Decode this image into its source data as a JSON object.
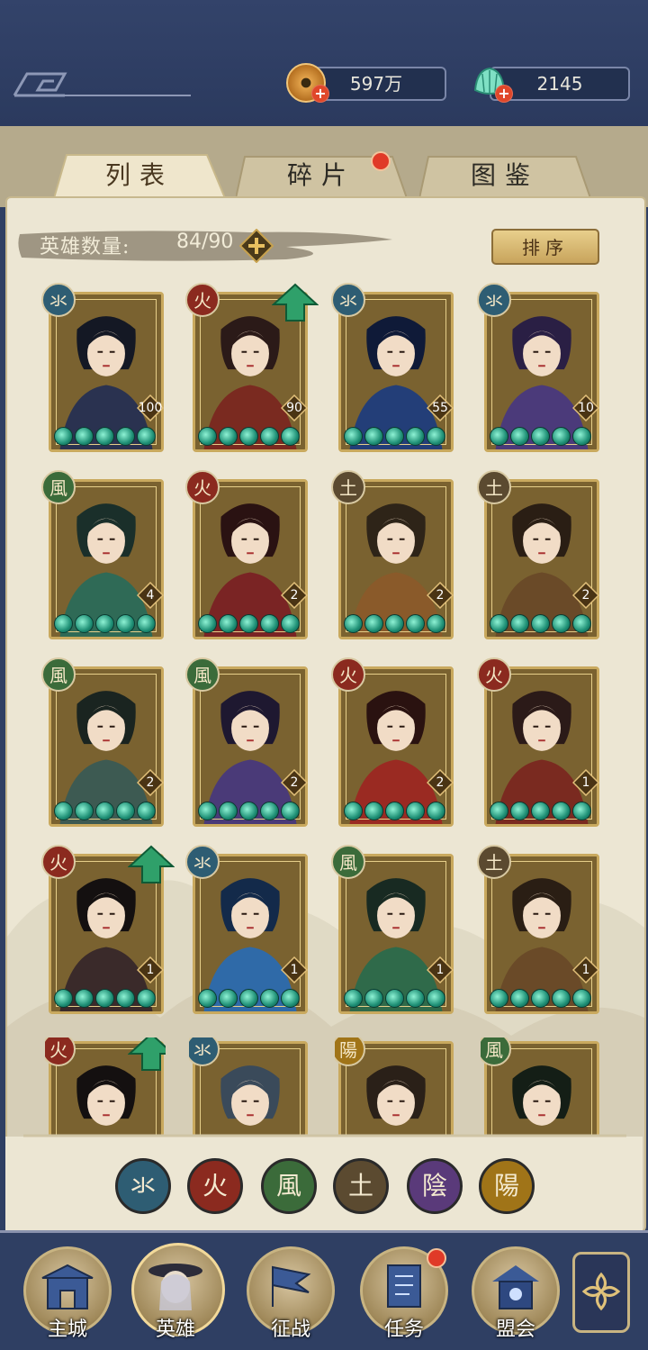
{
  "currency": {
    "coins": {
      "value": "597万",
      "icon": "copper-coin-icon"
    },
    "jade": {
      "value": "2145",
      "icon": "jade-shell-icon"
    }
  },
  "tabs": [
    {
      "label": "列表",
      "active": true
    },
    {
      "label": "碎片",
      "active": false,
      "badge": true
    },
    {
      "label": "图鉴",
      "active": false
    }
  ],
  "hero_count": {
    "label": "英雄数量:",
    "value": "84/90"
  },
  "sort_label": "排序",
  "elements": {
    "water": {
      "glyph": "氺",
      "color": "#2e5d73"
    },
    "fire": {
      "glyph": "火",
      "color": "#8b2a1f"
    },
    "wind": {
      "glyph": "風",
      "color": "#3b6b3a"
    },
    "earth": {
      "glyph": "土",
      "color": "#5b4a30"
    },
    "yin": {
      "glyph": "陰",
      "color": "#5a3a7a"
    },
    "yang": {
      "glyph": "陽",
      "color": "#a07418"
    }
  },
  "heroes": [
    {
      "element": "water",
      "level": "100",
      "upgrade": false,
      "palette": [
        "#2a3250",
        "#141824"
      ]
    },
    {
      "element": "fire",
      "level": "90",
      "upgrade": true,
      "palette": [
        "#7a2a20",
        "#2b1a18"
      ]
    },
    {
      "element": "water",
      "level": "55",
      "upgrade": false,
      "palette": [
        "#233e78",
        "#0f1a38"
      ]
    },
    {
      "element": "water",
      "level": "10",
      "upgrade": false,
      "palette": [
        "#4b3a7a",
        "#2a1f44"
      ]
    },
    {
      "element": "wind",
      "level": "4",
      "upgrade": false,
      "palette": [
        "#2f6a56",
        "#1a2f2a"
      ]
    },
    {
      "element": "fire",
      "level": "2",
      "upgrade": false,
      "palette": [
        "#7a2424",
        "#2a1212"
      ]
    },
    {
      "element": "earth",
      "level": "2",
      "upgrade": false,
      "palette": [
        "#8a5a2a",
        "#2e2418"
      ]
    },
    {
      "element": "earth",
      "level": "2",
      "upgrade": false,
      "palette": [
        "#6a4a28",
        "#2a1e14"
      ]
    },
    {
      "element": "wind",
      "level": "2",
      "upgrade": false,
      "palette": [
        "#3d5a52",
        "#1a2420"
      ]
    },
    {
      "element": "wind",
      "level": "2",
      "upgrade": false,
      "palette": [
        "#4a3a78",
        "#1e1830"
      ]
    },
    {
      "element": "fire",
      "level": "2",
      "upgrade": false,
      "palette": [
        "#9a2a22",
        "#2a1210"
      ]
    },
    {
      "element": "fire",
      "level": "1",
      "upgrade": false,
      "palette": [
        "#7a2a20",
        "#2b1a18"
      ]
    },
    {
      "element": "fire",
      "level": "1",
      "upgrade": true,
      "palette": [
        "#3a2a2a",
        "#141010"
      ]
    },
    {
      "element": "water",
      "level": "1",
      "upgrade": false,
      "palette": [
        "#2f6aa8",
        "#132a4a"
      ]
    },
    {
      "element": "wind",
      "level": "1",
      "upgrade": false,
      "palette": [
        "#2f6a4a",
        "#182a22"
      ]
    },
    {
      "element": "earth",
      "level": "1",
      "upgrade": false,
      "palette": [
        "#6a4a28",
        "#2a1e14"
      ]
    },
    {
      "element": "fire",
      "level": "",
      "upgrade": true,
      "palette": [
        "#3a2a2a",
        "#141010"
      ]
    },
    {
      "element": "water",
      "level": "",
      "upgrade": false,
      "palette": [
        "#9ab0c8",
        "#3a4a5a"
      ]
    },
    {
      "element": "yang",
      "level": "",
      "upgrade": false,
      "palette": [
        "#5a4030",
        "#2a2018"
      ]
    },
    {
      "element": "wind",
      "level": "",
      "upgrade": false,
      "palette": [
        "#2a4a32",
        "#141e16"
      ]
    }
  ],
  "filters": [
    "water",
    "fire",
    "wind",
    "earth",
    "yin",
    "yang"
  ],
  "nav": [
    {
      "label": "主城",
      "icon": "city-gate-icon"
    },
    {
      "label": "英雄",
      "icon": "hero-portrait-icon",
      "active": true
    },
    {
      "label": "征战",
      "icon": "war-banner-icon"
    },
    {
      "label": "任务",
      "icon": "quest-scroll-icon",
      "badge": true
    },
    {
      "label": "盟会",
      "icon": "alliance-pavilion-icon"
    }
  ],
  "more_icon": "flower-menu-icon"
}
